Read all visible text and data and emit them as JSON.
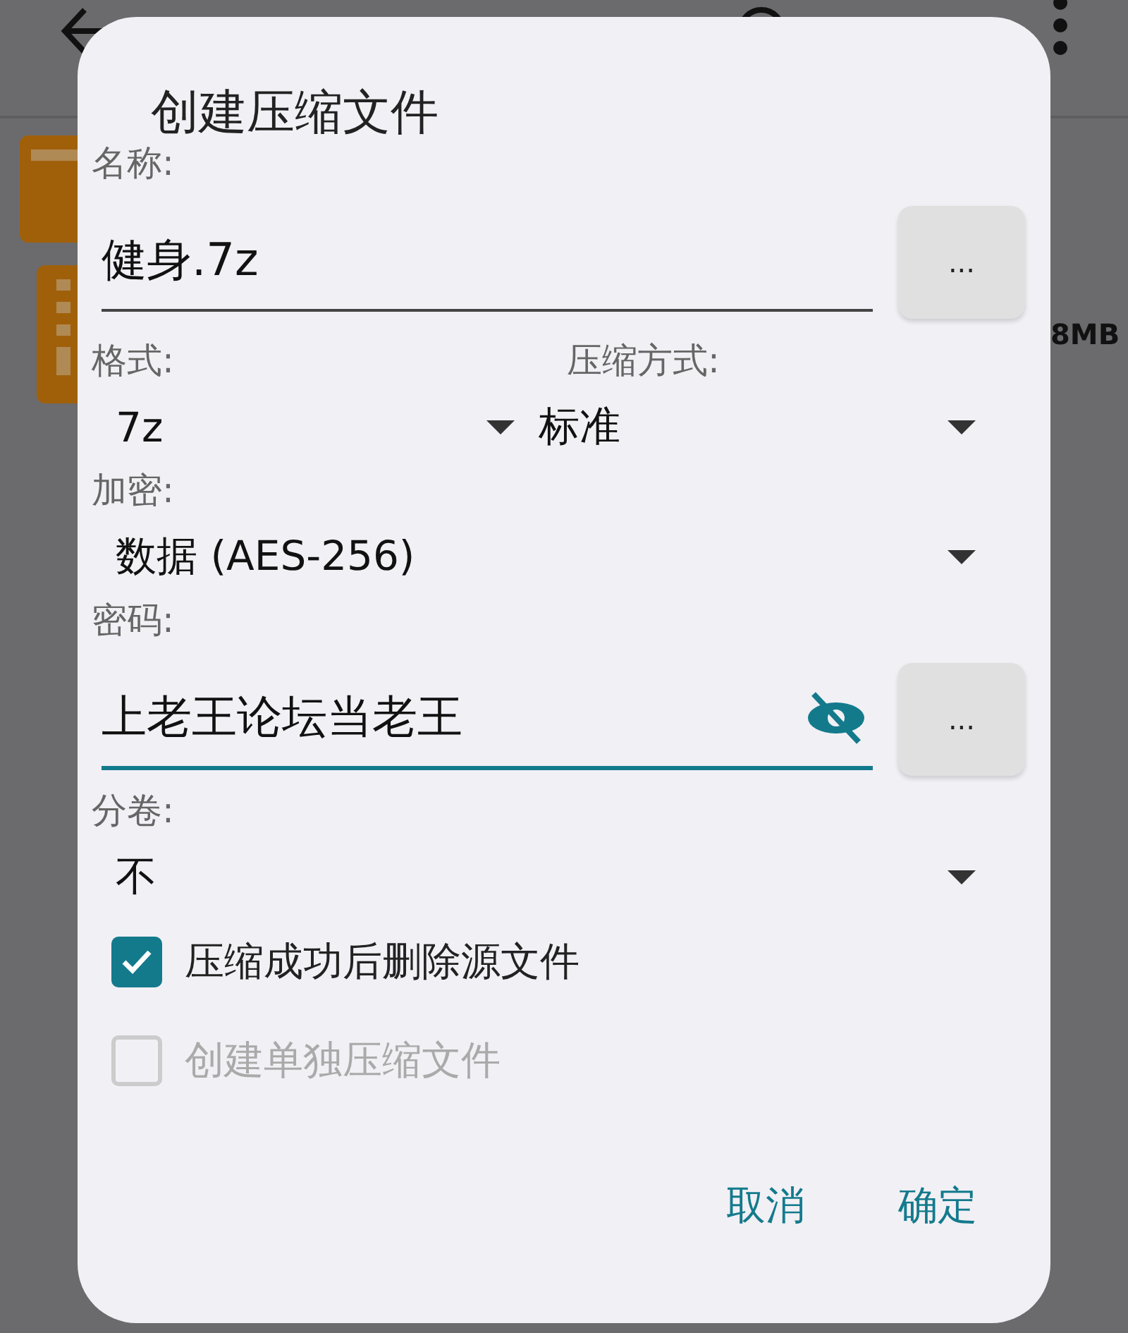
{
  "background": {
    "files": [
      {
        "kind": "folder"
      },
      {
        "kind": "archive",
        "size": "8MB"
      }
    ]
  },
  "dialog": {
    "title": "创建压缩文件",
    "name": {
      "label": "名称:",
      "value": "健身.7z",
      "button": "..."
    },
    "format": {
      "label": "格式:",
      "value": "7z"
    },
    "method": {
      "label": "压缩方式:",
      "value": "标准"
    },
    "encryption": {
      "label": "加密:",
      "value": "数据 (AES-256)"
    },
    "password": {
      "label": "密码:",
      "value": "上老王论坛当老王",
      "revealed": true,
      "focused": true,
      "button": "..."
    },
    "split": {
      "label": "分卷:",
      "value": "不"
    },
    "checkboxes": [
      {
        "label": "压缩成功后删除源文件",
        "checked": true,
        "disabled": false
      },
      {
        "label": "创建单独压缩文件",
        "checked": false,
        "disabled": true
      }
    ],
    "buttons": [
      "取消",
      "确定"
    ]
  }
}
